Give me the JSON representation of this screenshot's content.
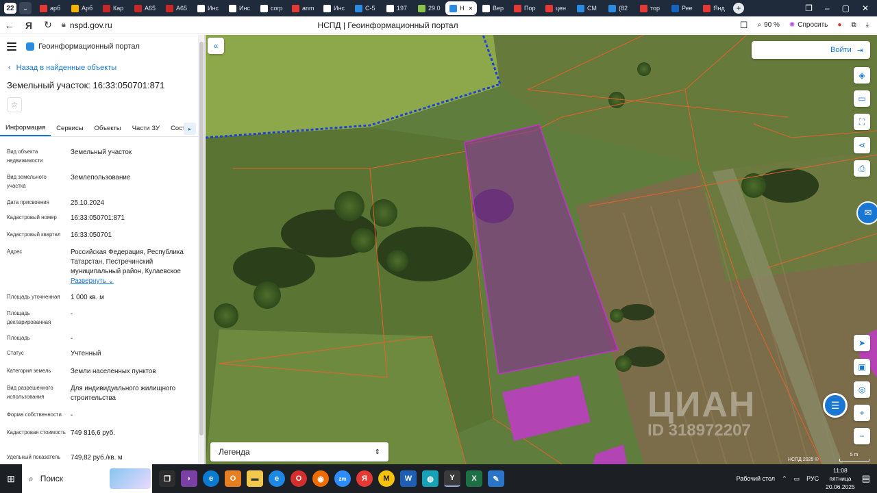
{
  "browser": {
    "tab_count": "22",
    "tabs": [
      {
        "label": "арб",
        "color": "#e53935"
      },
      {
        "label": "Арб",
        "color": "#f4b400"
      },
      {
        "label": "Кар",
        "color": "#c62828"
      },
      {
        "label": "А65",
        "color": "#c62828"
      },
      {
        "label": "А65",
        "color": "#c62828"
      },
      {
        "label": "Инс",
        "color": "#ffffff"
      },
      {
        "label": "Инс",
        "color": "#ffffff"
      },
      {
        "label": "corp",
        "color": "#ffffff"
      },
      {
        "label": "anm",
        "color": "#e53935"
      },
      {
        "label": "Инс",
        "color": "#ffffff"
      },
      {
        "label": "С-5",
        "color": "#2a8be0"
      },
      {
        "label": "197",
        "color": "#ffffff"
      },
      {
        "label": "29.0",
        "color": "#8bc34a"
      },
      {
        "label": "Н",
        "color": "#2a8be0",
        "active": true
      },
      {
        "label": "Вер",
        "color": "#ffffff"
      },
      {
        "label": "Пор",
        "color": "#e53935"
      },
      {
        "label": "цен",
        "color": "#e53935"
      },
      {
        "label": "СМ",
        "color": "#2a8be0"
      },
      {
        "label": "(82",
        "color": "#2a8be0"
      },
      {
        "label": "тор",
        "color": "#e53935"
      },
      {
        "label": "Рее",
        "color": "#1565c0"
      },
      {
        "label": "Янд",
        "color": "#e53935"
      }
    ],
    "url": "nspd.gov.ru",
    "page_title": "НСПД | Геоинформационный портал",
    "zoom": "90 %",
    "ask_label": "Спросить"
  },
  "sidebar": {
    "portal_name": "Геоинформационный портал",
    "back_label": "Назад в найденные объекты",
    "title": "Земельный участок: 16:33:050701:871",
    "tabs": [
      {
        "label": "Информация",
        "active": true
      },
      {
        "label": "Сервисы"
      },
      {
        "label": "Объекты"
      },
      {
        "label": "Части ЗУ"
      },
      {
        "label": "Сост"
      }
    ],
    "properties": [
      {
        "label": "Вид объекта недвижимости",
        "value": "Земельный участок"
      },
      {
        "label": "Вид земельного участка",
        "value": "Землепользование"
      },
      {
        "label": "Дата присвоения",
        "value": "25.10.2024"
      },
      {
        "label": "Кадастровый номер",
        "value": "16:33:050701:871"
      },
      {
        "label": "Кадастровый квартал",
        "value": "16:33:050701"
      },
      {
        "label": "Адрес",
        "value": "Российская Федерация, Республика Татарстан, Пестречинский муниципальный район, Кулаевское",
        "extra": "Развернуть"
      },
      {
        "label": "Площадь уточненная",
        "value": "1 000 кв. м"
      },
      {
        "label": "Площадь декларированная",
        "value": "-"
      },
      {
        "label": "Площадь",
        "value": "-"
      },
      {
        "label": "Статус",
        "value": "Учтенный"
      },
      {
        "label": "Категория земель",
        "value": "Земли населенных пунктов"
      },
      {
        "label": "Вид разрешенного использования",
        "value": "Для индивидуального жилищного строительства"
      },
      {
        "label": "Форма собственности",
        "value": "-"
      },
      {
        "label": "Кадастровая стоимость",
        "value": "749 816,6 руб."
      },
      {
        "label": "Удельный показатель",
        "value": "749,82 руб./кв. м"
      }
    ]
  },
  "map": {
    "login_label": "Войти",
    "legend_label": "Легенда",
    "watermark": "ЦИАН",
    "watermark_id": "ID 318972207",
    "attribution": "НСПД 2025 ©",
    "scale_label": "5 m",
    "parcel_color": "#b01fb5"
  },
  "taskbar": {
    "search_label": "Поиск",
    "desktop_label": "Рабочий стол",
    "lang": "РУС",
    "time": "11:08",
    "weekday": "пятница",
    "date": "20.06.2025"
  }
}
